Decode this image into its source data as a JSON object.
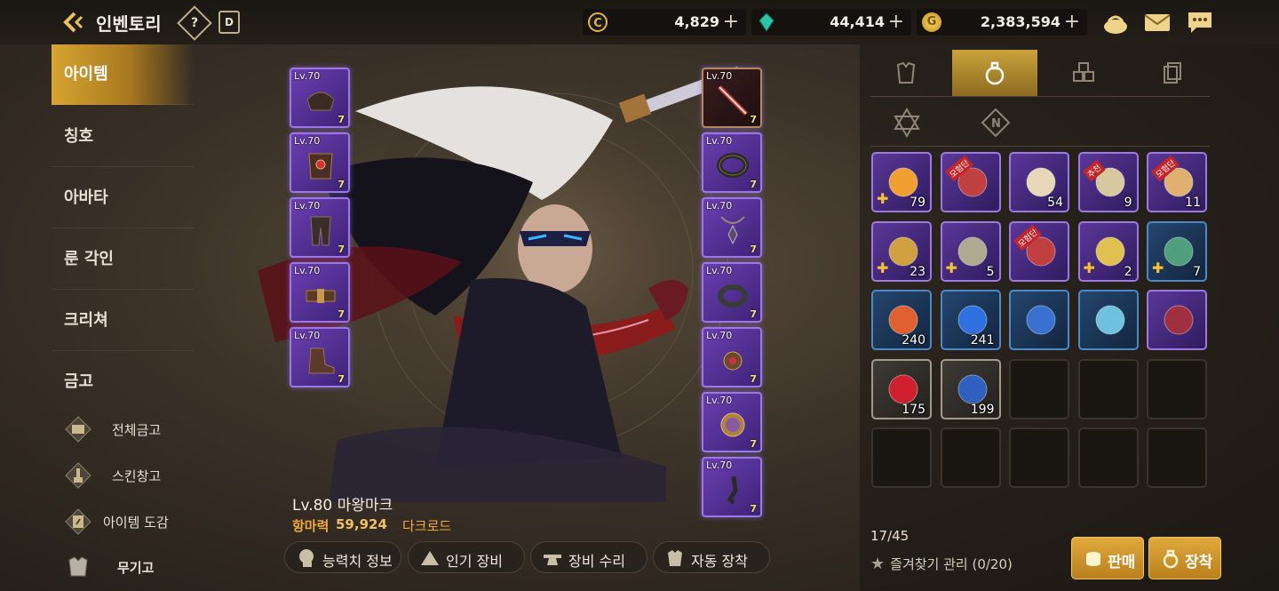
{
  "topbar": {
    "title": "인벤토리",
    "help_label": "?",
    "d_label": "D",
    "currencies": [
      {
        "icon": "c-coin-icon",
        "symbol": "C",
        "value": "4,829"
      },
      {
        "icon": "crystal-icon",
        "symbol": "",
        "value": "44,414"
      },
      {
        "icon": "gold-icon",
        "symbol": "G",
        "value": "2,383,594"
      }
    ],
    "plus": "+"
  },
  "sidebar": {
    "items": [
      "아이템",
      "칭호",
      "아바타",
      "룬 각인",
      "크리쳐",
      "금고"
    ],
    "sub_items": [
      "전체금고",
      "스킨창고",
      "아이템 도감",
      "무기고"
    ]
  },
  "equipment": {
    "left": [
      "Lv.70",
      "Lv.70",
      "Lv.70",
      "Lv.70",
      "Lv.70"
    ],
    "right": [
      "Lv.70",
      "Lv.70",
      "Lv.70",
      "Lv.70",
      "Lv.70",
      "Lv.70",
      "Lv.70"
    ],
    "grade": "7"
  },
  "character": {
    "name": "Lv.80 마왕마크",
    "power_label": "항마력",
    "power_value": "59,924",
    "class": "다크로드"
  },
  "actions": [
    "능력치 정보",
    "인기 장비",
    "장비 수리",
    "자동 장착"
  ],
  "inventory": {
    "cells": [
      {
        "type": "purple",
        "count": "79",
        "plus": true
      },
      {
        "type": "purple",
        "count": "",
        "tag": "모험단"
      },
      {
        "type": "purple",
        "count": "54"
      },
      {
        "type": "purple",
        "count": "9",
        "tag": "추천"
      },
      {
        "type": "purple",
        "count": "11",
        "tag": "모험단"
      },
      {
        "type": "purple",
        "count": "23",
        "plus": true
      },
      {
        "type": "purple",
        "count": "5",
        "plus": true
      },
      {
        "type": "purple",
        "count": "",
        "tag": "모험단"
      },
      {
        "type": "purple",
        "count": "2",
        "plus": true
      },
      {
        "type": "blue",
        "count": "7",
        "plus": true
      },
      {
        "type": "blue",
        "count": "240"
      },
      {
        "type": "blue",
        "count": "241"
      },
      {
        "type": "blue",
        "count": ""
      },
      {
        "type": "blue",
        "count": ""
      },
      {
        "type": "purple",
        "count": ""
      },
      {
        "type": "gray",
        "count": "175"
      },
      {
        "type": "gray",
        "count": "199"
      }
    ],
    "capacity": "17/45",
    "favorite": "즐겨찾기 관리 (0/20)",
    "sell": "판매",
    "equip": "장착"
  }
}
